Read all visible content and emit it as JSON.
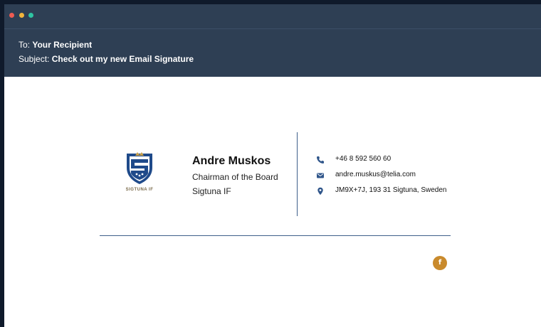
{
  "window": {
    "controls": [
      "close",
      "minimize",
      "maximize"
    ]
  },
  "email": {
    "to_label": "To:",
    "to_value": "Your Recipient",
    "subject_label": "Subject:",
    "subject_value": "Check out my new Email Signature"
  },
  "signature": {
    "logo": {
      "icon": "sigtuna-if-crest-icon",
      "text": "SIGTUNA IF"
    },
    "name": "Andre Muskos",
    "title": "Chairman of the Board",
    "organization": "Sigtuna IF",
    "contacts": {
      "phone": {
        "icon": "phone-icon",
        "value": "+46 8 592 560 60"
      },
      "email": {
        "icon": "email-icon",
        "value": "andre.muskus@telia.com"
      },
      "address": {
        "icon": "map-pin-icon",
        "value": "JM9X+7J, 193 31 Sigtuna, Sweden"
      }
    },
    "social": {
      "facebook": {
        "icon": "facebook-icon",
        "glyph": "f"
      }
    }
  },
  "colors": {
    "header_bg": "#2e3f54",
    "accent_blue": "#3e5f8a",
    "facebook_gold": "#c98a2c",
    "dot_red": "#ef5b52",
    "dot_yellow": "#f2b53c",
    "dot_green": "#2ec4a2"
  }
}
